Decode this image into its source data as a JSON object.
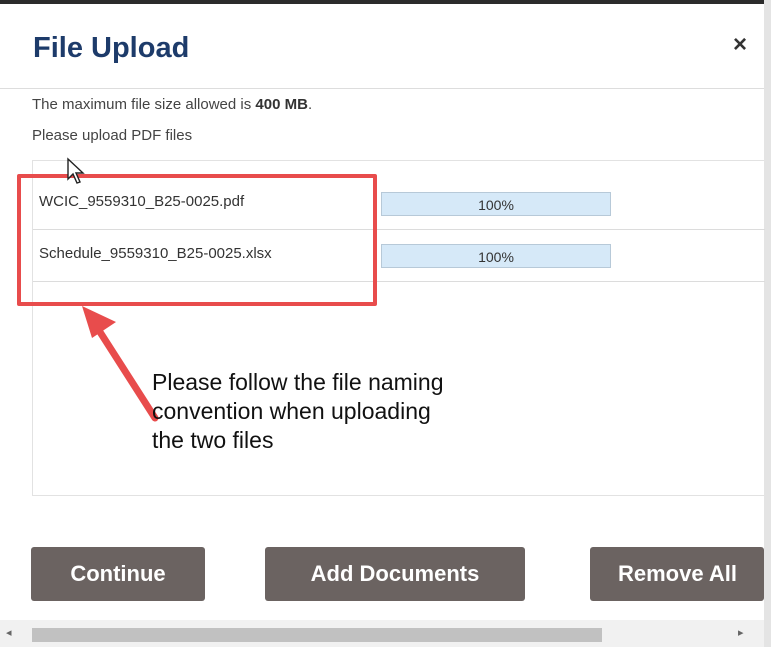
{
  "dialog": {
    "title": "File Upload",
    "close_icon": "close-icon",
    "max_size_prefix": "The maximum file size allowed is ",
    "max_size_value": "400 MB",
    "max_size_suffix": ".",
    "upload_hint": "Please upload PDF files"
  },
  "files": [
    {
      "name": "WCIC_9559310_B25-0025.pdf",
      "progress_label": "100%",
      "progress": 1.0
    },
    {
      "name": "Schedule_9559310_B25-0025.xlsx",
      "progress_label": "100%",
      "progress": 1.0
    }
  ],
  "annotation": {
    "lines": [
      "Please follow the file naming",
      "convention when uploading",
      "the two files"
    ],
    "highlight_color": "#e84c4c"
  },
  "buttons": {
    "continue": "Continue",
    "add_documents": "Add Documents",
    "remove_all": "Remove All"
  },
  "scrollbar": {
    "left_arrow": "◂",
    "right_arrow": "▸"
  },
  "colors": {
    "title": "#1d3b6a",
    "button_bg": "#6b6361",
    "progress_bg": "#d9ebf8"
  }
}
